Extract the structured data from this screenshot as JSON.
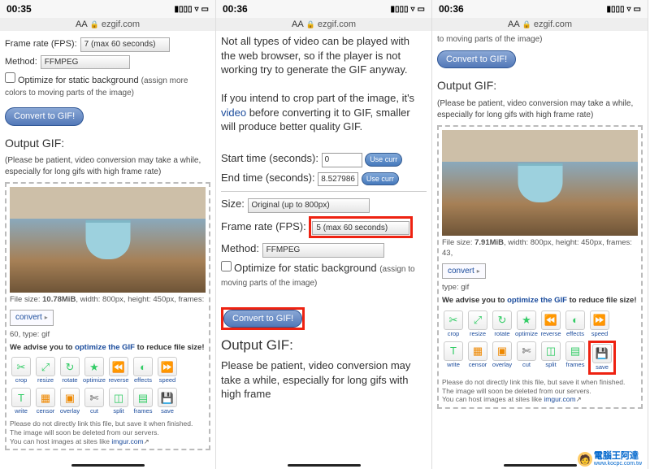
{
  "site": "ezgif.com",
  "s1": {
    "time": "00:35",
    "frame_rate_label": "Frame rate (FPS):",
    "frame_rate_value": "7 (max 60 seconds)",
    "method_label": "Method:",
    "method_value": "FFMPEG",
    "opt_label": "Optimize for static background",
    "opt_sub": "(assign more colors to moving parts of the image)",
    "convert_btn": "Convert to GIF!",
    "output_h": "Output GIF:",
    "patient": "(Please be patient, video conversion may take a while, especially for long gifs with high frame rate)",
    "meta_a": "File size: ",
    "meta_size": "10.78MiB",
    "meta_b": ", width: 800px, height: 450px, frames:",
    "meta_c": "60, type: gif",
    "convert_sm": "convert",
    "advise_a": "We advise you to ",
    "advise_b": "optimize the GIF",
    "advise_c": " to reduce file size!",
    "tools": [
      "crop",
      "resize",
      "rotate",
      "optimize",
      "reverse",
      "effects",
      "speed",
      "write",
      "censor",
      "overlay",
      "cut",
      "split",
      "frames",
      "save"
    ],
    "foot1": "Please do not directly link this file, but save it when finished.",
    "foot2": "The image will soon be deleted from our servers.",
    "foot3": "You can host images at sites like ",
    "foot_link": "imgur.com"
  },
  "s2": {
    "time": "00:36",
    "p1": "Not all types of video can be played with the web browser, so if the player is not working try to generate the GIF anyway.",
    "p2": "If you intend to crop part of the image, it's video before converting it to GIF, smaller will produce better quality GIF.",
    "p2_link": "video",
    "start_label": "Start time (seconds):",
    "start_value": "0",
    "end_label": "End time (seconds):",
    "end_value": "8.527986",
    "usecur": "Use curr",
    "size_label": "Size:",
    "size_value": "Original (up to 800px)",
    "fps_label": "Frame rate (FPS):",
    "fps_value": "5 (max 60 seconds)",
    "method_label": "Method:",
    "method_value": "FFMPEG",
    "opt_label": "Optimize for static background",
    "opt_sub": "(assign to moving parts of the image)",
    "convert_btn": "Convert to GIF!",
    "output_h": "Output GIF:",
    "patient": "Please be patient, video conversion may take a while, especially for long gifs with high frame"
  },
  "s3": {
    "time": "00:36",
    "top_txt": "to moving parts of the image)",
    "convert_btn": "Convert to GIF!",
    "output_h": "Output GIF:",
    "patient": "(Please be patient, video conversion may take a while, especially for long gifs with high frame rate)",
    "meta_a": "File size: ",
    "meta_size": "7.91MiB",
    "meta_b": ", width: 800px, height: 450px, frames: 43,",
    "meta_c": "type: gif",
    "convert_sm": "convert",
    "advise_a": "We advise you to ",
    "advise_b": "optimize the GIF",
    "advise_c": " to reduce file size!",
    "tools": [
      "crop",
      "resize",
      "rotate",
      "optimize",
      "reverse",
      "effects",
      "speed",
      "write",
      "censor",
      "overlay",
      "cut",
      "split",
      "frames",
      "save"
    ],
    "foot1": "Please do not directly link this file, but save it when finished.",
    "foot2": "The image will soon be deleted from our servers.",
    "foot3": "You can host images at sites like ",
    "foot_link": "imgur.com"
  },
  "watermark": {
    "title": "電腦王阿達",
    "url": "www.kocpc.com.tw"
  }
}
